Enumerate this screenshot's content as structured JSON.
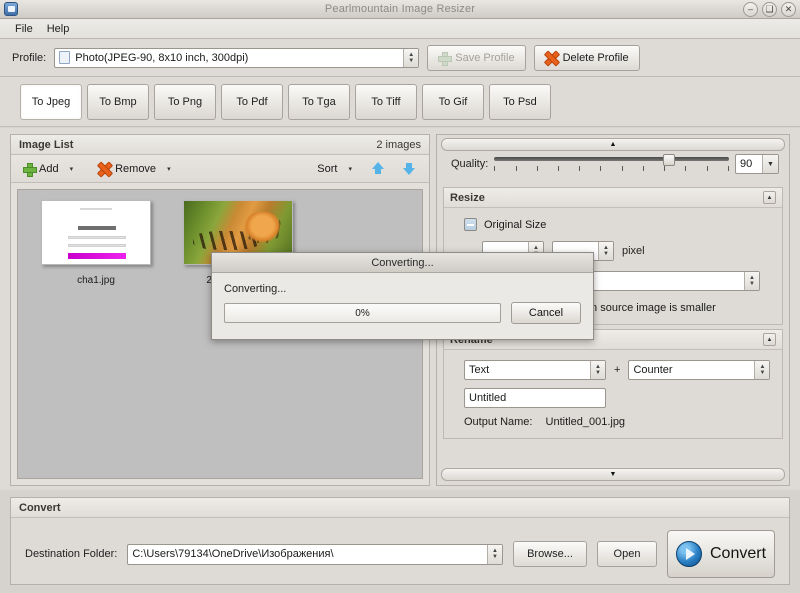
{
  "window": {
    "title": "Pearlmountain Image Resizer",
    "minimize": "–",
    "maximize": "❑",
    "close": "✕"
  },
  "menu": {
    "items": [
      "File",
      "Help"
    ]
  },
  "profile": {
    "label": "Profile:",
    "value": "Photo(JPEG-90, 8x10 inch, 300dpi)",
    "save_label": "Save Profile",
    "delete_label": "Delete Profile"
  },
  "tabs": [
    {
      "label": "To Jpeg",
      "active": true
    },
    {
      "label": "To Bmp",
      "active": false
    },
    {
      "label": "To Png",
      "active": false
    },
    {
      "label": "To Pdf",
      "active": false
    },
    {
      "label": "To Tga",
      "active": false
    },
    {
      "label": "To Tiff",
      "active": false
    },
    {
      "label": "To Gif",
      "active": false
    },
    {
      "label": "To Psd",
      "active": false
    }
  ],
  "image_list": {
    "title": "Image List",
    "count": "2 images",
    "add_label": "Add",
    "remove_label": "Remove",
    "sort_label": "Sort",
    "caret": "▾",
    "items": [
      {
        "name": "cha1.jpg"
      },
      {
        "name": "2020Animals_"
      }
    ]
  },
  "settings": {
    "quality": {
      "label": "Quality:",
      "value": "90"
    },
    "resize": {
      "title": "Resize",
      "original_size_label": "Original Size",
      "width": "",
      "height": "",
      "unit": "pixel",
      "mode": "",
      "no_upscale_label": "Do not resize when source image is smaller"
    },
    "rename": {
      "title": "Rename",
      "part1": "Text",
      "plus": "+",
      "part2": "Counter",
      "text_value": "Untitled",
      "output_label": "Output Name:",
      "output_value": "Untitled_001.jpg"
    },
    "scroll_up": "▲",
    "scroll_down": "▼",
    "collapse": "▲"
  },
  "convert": {
    "title": "Convert",
    "dest_label": "Destination Folder:",
    "dest_value": "C:\\Users\\79134\\OneDrive\\Изображения\\",
    "browse_label": "Browse...",
    "open_label": "Open",
    "convert_label": "Convert"
  },
  "dialog": {
    "title": "Converting...",
    "status": "Converting...",
    "progress_text": "0%",
    "progress_percent": 0,
    "cancel_label": "Cancel"
  },
  "colors": {
    "accent_blue": "#2a7fc4",
    "add_green": "#6cb33f",
    "remove_orange": "#e8621c",
    "arrow_blue": "#56b3e8"
  }
}
